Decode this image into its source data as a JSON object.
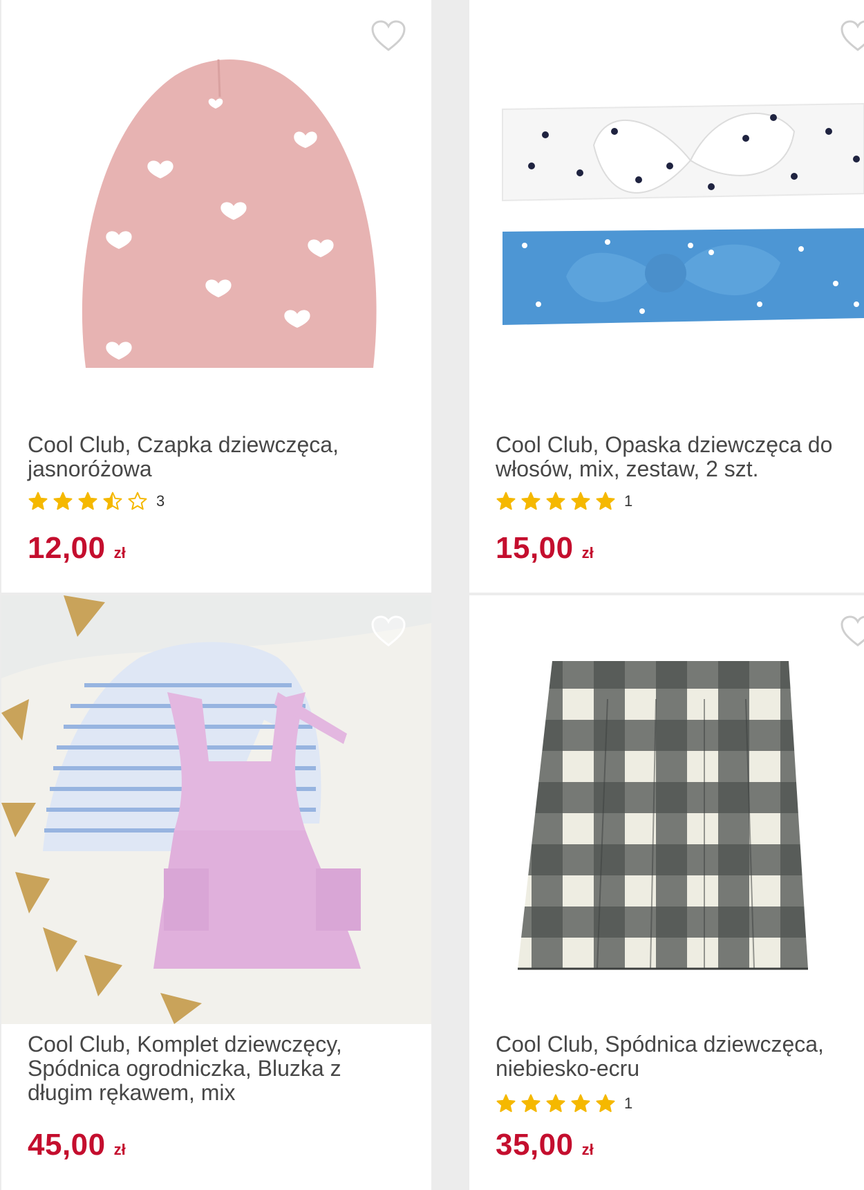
{
  "products": [
    {
      "title": "Cool Club, Czapka dziewczęca, jasnoróżowa",
      "rating": 3.5,
      "reviews": "3",
      "price": "12,00",
      "currency": "zł",
      "icon": "heart-outline-icon"
    },
    {
      "title": "Cool Club, Opaska dziewczęca do włosów, mix, zestaw, 2 szt.",
      "rating": 5,
      "reviews": "1",
      "price": "15,00",
      "currency": "zł",
      "icon": "heart-outline-icon"
    },
    {
      "title": "Cool Club, Komplet dziewczęcy, Spódnica ogrodniczka, Bluzka z długim rękawem, mix",
      "price": "45,00",
      "currency": "zł",
      "icon": "heart-outline-icon"
    },
    {
      "title": "Cool Club, Spódnica dziewczęca, niebiesko-ecru",
      "rating": 5,
      "reviews": "1",
      "price": "35,00",
      "currency": "zł",
      "icon": "heart-outline-icon"
    }
  ],
  "colors": {
    "price": "#c40e2e",
    "star": "#f5b800",
    "text": "#474747",
    "divider": "#ececec"
  }
}
